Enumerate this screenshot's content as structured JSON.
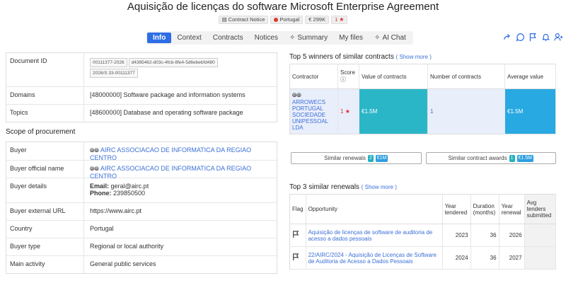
{
  "header": {
    "title": "Aquisição de licenças do software Microsoft Enterprise Agreement",
    "chips": {
      "notice": "Contract Notice",
      "country": "Portugal",
      "value": "€ 299K",
      "score": "1"
    }
  },
  "tabs": [
    {
      "label": "Info"
    },
    {
      "label": "Context"
    },
    {
      "label": "Contracts"
    },
    {
      "label": "Notices"
    },
    {
      "label": "Summary"
    },
    {
      "label": "My files"
    },
    {
      "label": "AI Chat"
    }
  ],
  "left": {
    "doc": {
      "document_id_label": "Document ID",
      "ids": [
        "00111377-2026",
        "d4365462-d03c-4fcb-8fe4-5d6ebebfd480",
        "2026/S 33-00111377"
      ],
      "domains_label": "Domains",
      "domains_value": "[48000000] Software package and information systems",
      "topics_label": "Topics",
      "topics_value": "[48600000] Database and operating software package"
    },
    "scope_title": "Scope of procurement",
    "scope": {
      "buyer_label": "Buyer",
      "buyer_value": "AIRC ASSOCIACAO DE INFORMATICA DA REGIAO CENTRO",
      "buyer_official_label": "Buyer official name",
      "buyer_official_value": "AIRC ASSOCIACAO DE INFORMATICA DA REGIAO CENTRO",
      "buyer_details_label": "Buyer details",
      "email_label": "Email:",
      "email_value": "geral@airc.pt",
      "phone_label": "Phone:",
      "phone_value": "239850500",
      "buyer_url_label": "Buyer external URL",
      "buyer_url_value": "https://www.airc.pt",
      "country_label": "Country",
      "country_value": "Portugal",
      "buyer_type_label": "Buyer type",
      "buyer_type_value": "Regional or local authority",
      "main_activity_label": "Main activity",
      "main_activity_value": "General public services"
    }
  },
  "winners": {
    "title": "Top 5 winners of similar contracts",
    "show_more": "( Show more )",
    "headers": {
      "contractor": "Contractor",
      "score": "Score",
      "value": "Value of contracts",
      "number": "Number of contracts",
      "average": "Average value"
    },
    "row": {
      "contractor": "ARROWECS PORTUGAL SOCIEDADE UNIPESSOAL LDA",
      "score": "1",
      "value": "€1.5M",
      "number": "1",
      "average": "€1.5M"
    }
  },
  "similar_buttons": {
    "renewals_label": "Similar renewals",
    "renewals_count": "2",
    "renewals_value": "€1M",
    "awards_label": "Similar contract awards",
    "awards_count": "1",
    "awards_value": "€1.5M"
  },
  "renewals": {
    "title": "Top 3 similar renewals",
    "show_more": "( Show more )",
    "headers": {
      "flag": "Flag",
      "opportunity": "Opportunity",
      "year_tendered": "Year tendered",
      "duration": "Duration (months)",
      "year_renewal": "Year renewal",
      "avg_tenders": "Avg tenders submitted"
    },
    "rows": [
      {
        "opportunity": "Aquisição de licenças de software de auditoria de acesso a dados pessoais",
        "year_tendered": "2023",
        "duration": "36",
        "year_renewal": "2026"
      },
      {
        "opportunity": "22/AIRC/2024 - Aquisição de Licenças de Software de Auditoria de Acesso a Dados Pessoais",
        "year_tendered": "2024",
        "duration": "36",
        "year_renewal": "2027"
      }
    ]
  },
  "colors": {
    "accent": "#2e6de6",
    "value_cell": "#2bb6c8",
    "average_cell": "#29a9e2",
    "score_star": "#d92a2a"
  }
}
